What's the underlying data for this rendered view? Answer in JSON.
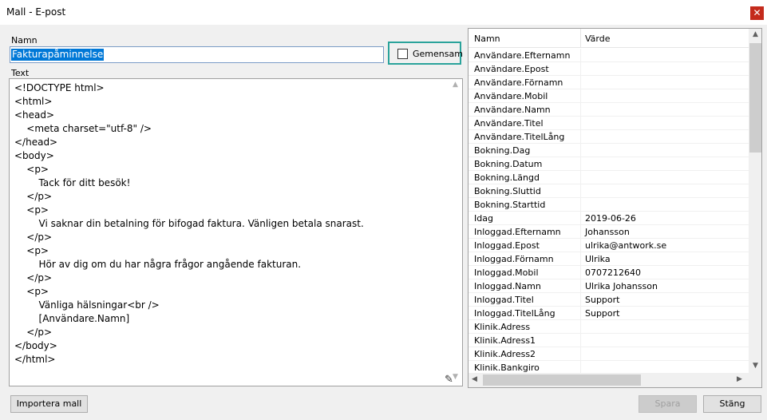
{
  "window": {
    "title": "Mall - E-post",
    "close_icon": "✕"
  },
  "form": {
    "name_label": "Namn",
    "name_value": "Fakturapåminnelse",
    "shared_label": "Gemensam",
    "shared_checked": false,
    "text_label": "Text",
    "text_lines": [
      "<!DOCTYPE html>",
      "<html>",
      "<head>",
      "    <meta charset=\"utf-8\" />",
      "</head>",
      "<body>",
      "    <p>",
      "        Tack för ditt besök!",
      "    </p>",
      "    <p>",
      "        Vi saknar din betalning för bifogad faktura. Vänligen betala snarast.",
      "    </p>",
      "    <p>",
      "        Hör av dig om du har några frågor angående fakturan.",
      "    </p>",
      "    <p>",
      "        Vänliga hälsningar<br />",
      "        [Användare.Namn]",
      "    </p>",
      "</body>",
      "</html>"
    ]
  },
  "variables": {
    "col_name": "Namn",
    "col_value": "Värde",
    "rows": [
      {
        "name": "Användare.Efternamn",
        "value": ""
      },
      {
        "name": "Användare.Epost",
        "value": ""
      },
      {
        "name": "Användare.Förnamn",
        "value": ""
      },
      {
        "name": "Användare.Mobil",
        "value": ""
      },
      {
        "name": "Användare.Namn",
        "value": ""
      },
      {
        "name": "Användare.Titel",
        "value": ""
      },
      {
        "name": "Användare.TitelLång",
        "value": ""
      },
      {
        "name": "Bokning.Dag",
        "value": ""
      },
      {
        "name": "Bokning.Datum",
        "value": ""
      },
      {
        "name": "Bokning.Längd",
        "value": ""
      },
      {
        "name": "Bokning.Sluttid",
        "value": ""
      },
      {
        "name": "Bokning.Starttid",
        "value": ""
      },
      {
        "name": "Idag",
        "value": "2019-06-26"
      },
      {
        "name": "Inloggad.Efternamn",
        "value": "Johansson"
      },
      {
        "name": "Inloggad.Epost",
        "value": "ulrika@antwork.se"
      },
      {
        "name": "Inloggad.Förnamn",
        "value": "Ulrika"
      },
      {
        "name": "Inloggad.Mobil",
        "value": "0707212640"
      },
      {
        "name": "Inloggad.Namn",
        "value": "Ulrika Johansson"
      },
      {
        "name": "Inloggad.Titel",
        "value": "Support"
      },
      {
        "name": "Inloggad.TitelLång",
        "value": "Support"
      },
      {
        "name": "Klinik.Adress",
        "value": ""
      },
      {
        "name": "Klinik.Adress1",
        "value": ""
      },
      {
        "name": "Klinik.Adress2",
        "value": ""
      },
      {
        "name": "Klinik.Bankgiro",
        "value": ""
      }
    ]
  },
  "buttons": {
    "import_label": "Importera mall",
    "save_label": "Spara",
    "save_enabled": false,
    "close_label": "Stäng"
  }
}
